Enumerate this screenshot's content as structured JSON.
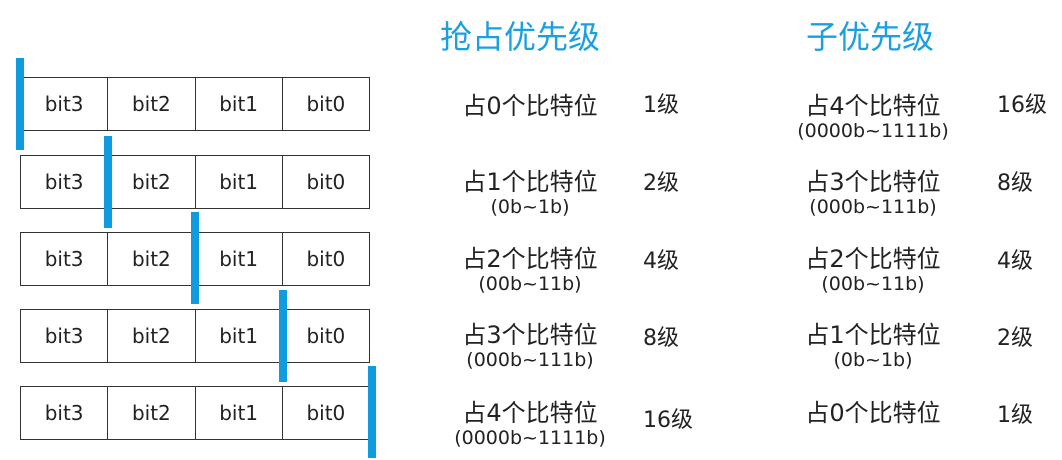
{
  "headings": {
    "preemption": "抢占优先级",
    "sub": "子优先级"
  },
  "bit_labels": [
    "bit3",
    "bit2",
    "bit1",
    "bit0"
  ],
  "rows": [
    {
      "preempt": {
        "label": "占0个比特位",
        "range": "",
        "level": "1级"
      },
      "sub": {
        "label": "占4个比特位",
        "range": "(0000b~1111b)",
        "level": "16级"
      }
    },
    {
      "preempt": {
        "label": "占1个比特位",
        "range": "(0b~1b)",
        "level": "2级"
      },
      "sub": {
        "label": "占3个比特位",
        "range": "(000b~111b)",
        "level": "8级"
      }
    },
    {
      "preempt": {
        "label": "占2个比特位",
        "range": "(00b~11b)",
        "level": "4级"
      },
      "sub": {
        "label": "占2个比特位",
        "range": "(00b~11b)",
        "level": "4级"
      }
    },
    {
      "preempt": {
        "label": "占3个比特位",
        "range": "(000b~111b)",
        "level": "8级"
      },
      "sub": {
        "label": "占1个比特位",
        "range": "(0b~1b)",
        "level": "2级"
      }
    },
    {
      "preempt": {
        "label": "占4个比特位",
        "range": "(0000b~1111b)",
        "level": "16级"
      },
      "sub": {
        "label": "占0个比特位",
        "range": "",
        "level": "1级"
      }
    }
  ],
  "colors": {
    "accent": "#1a9fe0",
    "divider": "#0e9be0"
  }
}
